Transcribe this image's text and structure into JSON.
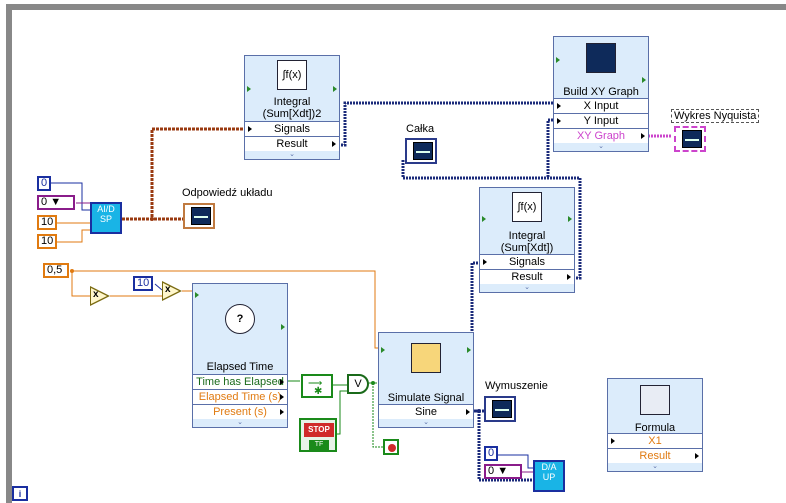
{
  "nodes": {
    "integral_sq": {
      "title": "Integral\n(Sum[Xdt])2",
      "rows": [
        "Signals",
        "Result"
      ],
      "icon": "integral-icon"
    },
    "integral": {
      "title": "Integral\n(Sum[Xdt])",
      "rows": [
        "Signals",
        "Result"
      ],
      "icon": "integral-icon"
    },
    "build_xy": {
      "title": "Build XY Graph",
      "rows": [
        "X Input",
        "Y Input",
        "XY Graph"
      ],
      "icon": "xy-graph-icon"
    },
    "elapsed": {
      "title": "Elapsed Time",
      "rows": [
        "Time has Elapsed",
        "Elapsed Time (s)",
        "Present (s)"
      ],
      "icon": "stopwatch-icon"
    },
    "simulate": {
      "title": "Simulate Signal",
      "rows": [
        "Sine"
      ],
      "icon": "signal-icon"
    },
    "formula": {
      "title": "Formula",
      "rows": [
        "X1",
        "Result"
      ],
      "icon": "calculator-icon"
    }
  },
  "indicators": {
    "odpowiedz": "Odpowiedź układu",
    "calka": "Całka",
    "nyquist": "Wykres Nyquista",
    "wymuszenie": "Wymuszenie"
  },
  "constants": {
    "c0": "0",
    "c_enum": "0",
    "c10a": "10",
    "c10b": "10",
    "c05": "0,5",
    "c10": "10",
    "c0b": "0",
    "c_enum_b": "0"
  },
  "subvis": {
    "ai": "AI/D SP",
    "ao": "D/A UP"
  },
  "operators": {
    "or": "V",
    "divide": "x",
    "multiply": "x"
  },
  "stop_button": {
    "face": "STOP",
    "tf": "TF"
  },
  "info_icon": "i",
  "colors": {
    "node_bg": "#dcecfb",
    "wire_dynamic": "#1a2a7a",
    "wire_orange": "#e07a10",
    "wire_green": "#1a8a1a",
    "wire_brown": "#9a3a10",
    "wire_pink": "#cc44cc"
  }
}
